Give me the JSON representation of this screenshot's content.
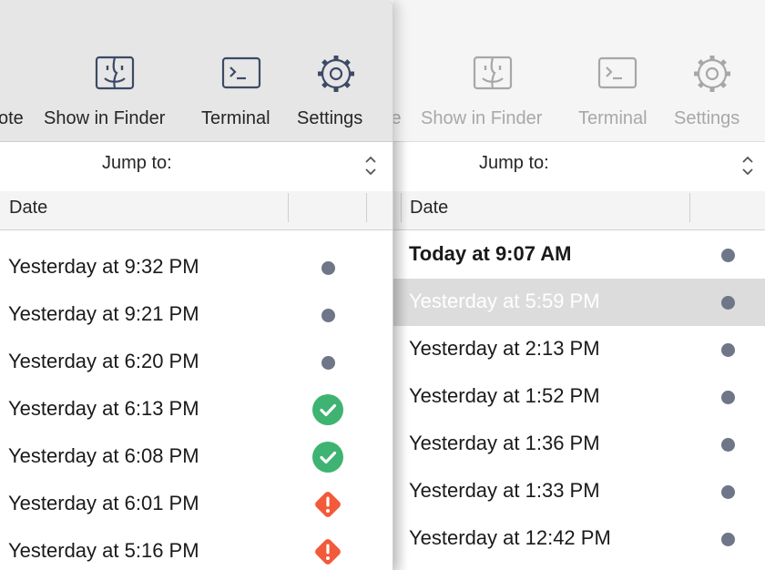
{
  "front": {
    "toolbar": {
      "partial_label": "ote",
      "show_in_finder": "Show in Finder",
      "terminal": "Terminal",
      "settings": "Settings"
    },
    "jump_to": "Jump to:",
    "column_date": "Date",
    "rows": [
      {
        "date": "Yesterday at 9:32 PM",
        "status": "dot"
      },
      {
        "date": "Yesterday at 9:21 PM",
        "status": "dot"
      },
      {
        "date": "Yesterday at 6:20 PM",
        "status": "dot"
      },
      {
        "date": "Yesterday at 6:13 PM",
        "status": "success"
      },
      {
        "date": "Yesterday at 6:08 PM",
        "status": "success"
      },
      {
        "date": "Yesterday at 6:01 PM",
        "status": "warning"
      },
      {
        "date": "Yesterday at 5:16 PM",
        "status": "warning"
      }
    ]
  },
  "back": {
    "toolbar": {
      "partial_label": "te",
      "show_in_finder": "Show in Finder",
      "terminal": "Terminal",
      "settings": "Settings"
    },
    "jump_to": "Jump to:",
    "column_date": "Date",
    "rows": [
      {
        "date": "Today at 9:07 AM",
        "status": "dot",
        "bold": true
      },
      {
        "date": "Yesterday at 5:59 PM",
        "status": "dot",
        "selected": true
      },
      {
        "date": "Yesterday at 2:13 PM",
        "status": "dot"
      },
      {
        "date": "Yesterday at 1:52 PM",
        "status": "dot"
      },
      {
        "date": "Yesterday at 1:36 PM",
        "status": "dot"
      },
      {
        "date": "Yesterday at 1:33 PM",
        "status": "dot"
      },
      {
        "date": "Yesterday at 12:42 PM",
        "status": "dot"
      }
    ]
  },
  "icons": {
    "finder": "finder-icon",
    "terminal": "terminal-icon",
    "settings": "gear-icon",
    "stepper": "chevron-updown-icon",
    "status_dot": "status-dot-icon",
    "status_success": "checkmark-circle-icon",
    "status_warning": "warning-diamond-icon"
  },
  "colors": {
    "icon_active": "#3c4a66",
    "icon_inactive": "#a7a7a7",
    "status_dot": "#6e7687",
    "success": "#3fb371",
    "warning": "#f25a3a",
    "selection": "#dcdcdc"
  }
}
